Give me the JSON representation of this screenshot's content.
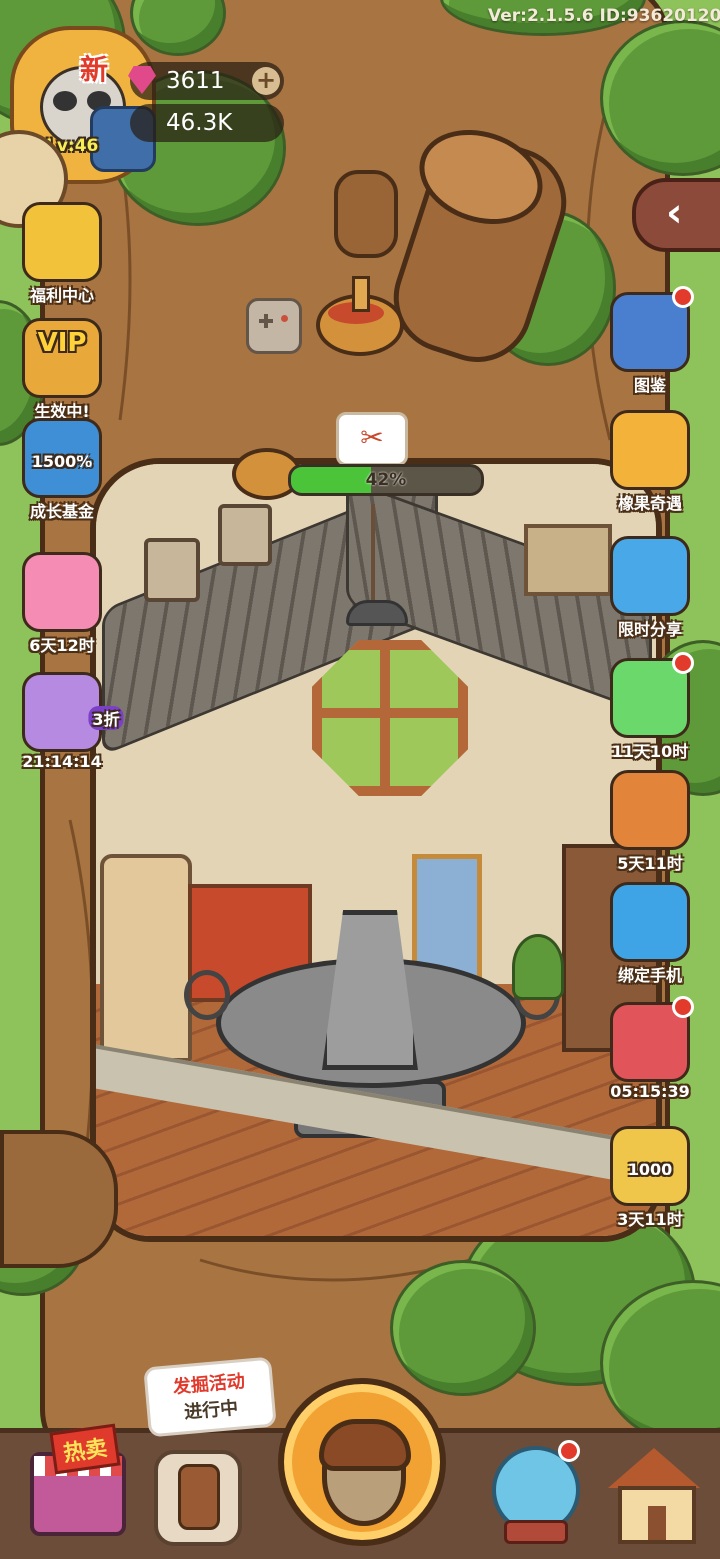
{
  "version_text": "Ver:2.1.5.6 ID:93620120",
  "player": {
    "level": "Lv:46",
    "new_badge": "新",
    "gems": "3611",
    "coins": "46.3K"
  },
  "progress": {
    "percent_text": "42%",
    "value": 0.42
  },
  "left_menu": [
    {
      "icon": "gift-box-icon",
      "label": "福利中心"
    },
    {
      "icon": "vip-icon",
      "label": "生效中!",
      "badge": "VIP"
    },
    {
      "icon": "growth-chart-icon",
      "label": "成长基金",
      "badge": "1500%"
    },
    {
      "icon": "piggy-bank-icon",
      "label": "6天12时"
    },
    {
      "icon": "alarm-clock-icon",
      "label": "21:14:14",
      "badge": "3折"
    }
  ],
  "right_menu": [
    {
      "icon": "book-icon",
      "label": "图鉴",
      "dot": true
    },
    {
      "icon": "acorn-bell-icon",
      "label": "橡果奇遇",
      "dot": false
    },
    {
      "icon": "share-icon",
      "label": "限时分享",
      "dot": false
    },
    {
      "icon": "bottle-icon",
      "label": "11天10时",
      "dot": true
    },
    {
      "icon": "fruit-basket-icon",
      "label": "5天11时",
      "dot": false
    },
    {
      "icon": "phone-link-icon",
      "label": "绑定手机",
      "dot": false
    },
    {
      "icon": "milk-box-icon",
      "label": "05:15:39",
      "dot": true
    },
    {
      "icon": "leaf-ticket-icon",
      "label": "3天11时",
      "dot": false,
      "badge": "1000"
    }
  ],
  "bottom": {
    "shop_badge": "热卖",
    "dig_bubble_line1": "发掘活动",
    "dig_bubble_line2": "进行中"
  },
  "colors": {
    "wood": "#9b6a3c",
    "outline": "#4a2d17",
    "leaf": "#5e9a3a",
    "grass": "#8ec25a",
    "progress_fill": "#4cc43a",
    "red_dot": "#e23b2b"
  }
}
